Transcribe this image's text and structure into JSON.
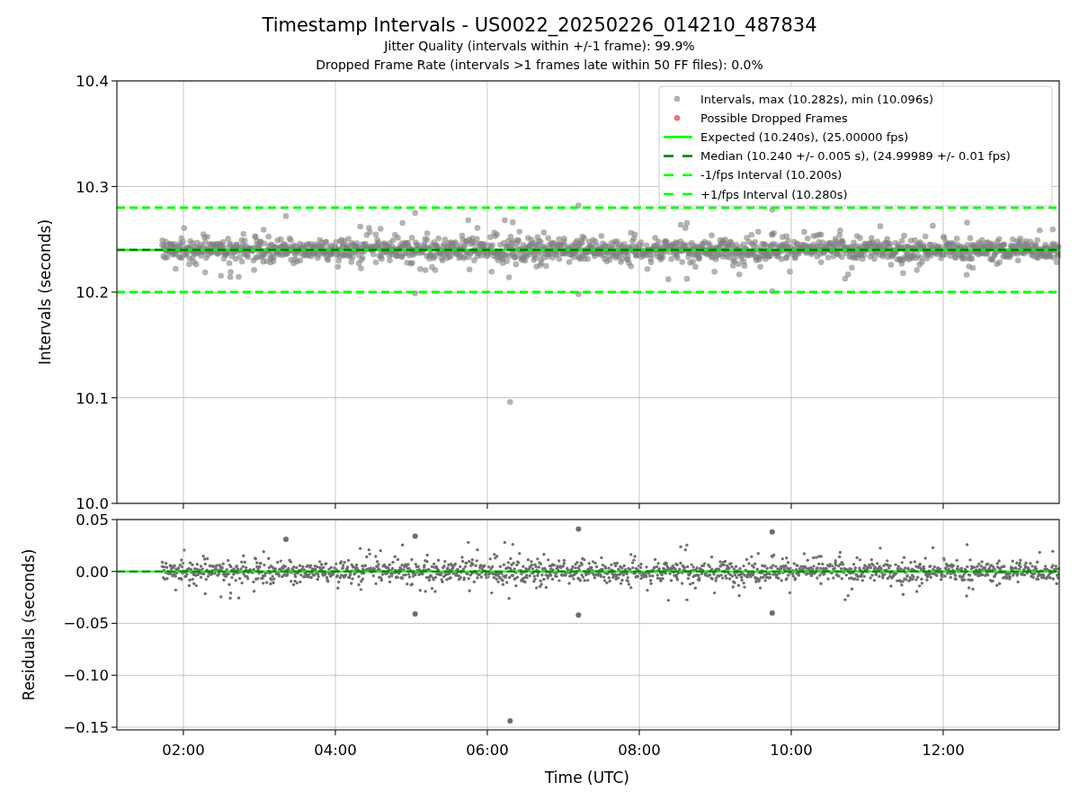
{
  "figure": {
    "title": "Timestamp Intervals - US0022_20250226_014210_487834",
    "subtitle_lines": [
      "Jitter Quality (intervals within +/-1 frame): 99.9%",
      "Dropped Frame Rate (intervals >1 frames late within 50 FF files): 0.0%"
    ]
  },
  "intervals_panel": {
    "legend": [
      {
        "label": "Intervals, max (10.282s), min (10.096s)",
        "kind": "dot",
        "color": "#b0b0b0"
      },
      {
        "label": "Possible Dropped Frames",
        "kind": "dot",
        "color": "#f87070"
      },
      {
        "label": "Expected (10.240s), (25.00000 fps)",
        "kind": "line",
        "color": "#00ff00"
      },
      {
        "label": "Median (10.240 +/- 0.005 s), (24.99989 +/- 0.01 fps)",
        "kind": "dashed",
        "color": "#008000"
      },
      {
        "label": "-1/fps Interval (10.200s)",
        "kind": "dashed",
        "color": "#00ff00"
      },
      {
        "label": "+1/fps Interval (10.280s)",
        "kind": "dashed",
        "color": "#00ff00"
      }
    ],
    "chart_data": {
      "type": "scatter",
      "ylabel": "Intervals (seconds)",
      "xlim": [
        1.125,
        13.527
      ],
      "ylim": [
        10.0,
        10.4
      ],
      "grid": true,
      "yticks": [
        {
          "value": 10.0,
          "label": "10.0"
        },
        {
          "value": 10.1,
          "label": "10.1"
        },
        {
          "value": 10.2,
          "label": "10.2"
        },
        {
          "value": 10.3,
          "label": "10.3"
        },
        {
          "value": 10.4,
          "label": "10.4"
        }
      ],
      "series": [
        {
          "color": "#808080",
          "x": [
            6.3,
            7.2,
            9.75,
            5.05,
            7.2,
            9.75,
            3.35,
            5.05
          ],
          "values": [
            10.096,
            10.282,
            10.278,
            10.199,
            10.198,
            10.201,
            10.272,
            10.275
          ]
        }
      ],
      "ref_lines": [
        {
          "axis": "y",
          "value": 10.24,
          "color": "#00ff00"
        },
        {
          "axis": "y",
          "value": 10.24,
          "color": "#008000"
        },
        {
          "axis": "y",
          "value": 10.2,
          "color": "#00ff00"
        },
        {
          "axis": "y",
          "value": 10.28,
          "color": "#00ff00"
        }
      ]
    }
  },
  "residuals_panel": {
    "chart_data": {
      "type": "scatter",
      "xlabel": "Time (UTC)",
      "ylabel": "Residuals (seconds)",
      "xlim": [
        1.125,
        13.527
      ],
      "ylim": [
        -0.1526,
        0.05
      ],
      "grid": true,
      "xticks": [
        {
          "value": 2,
          "label": "02:00"
        },
        {
          "value": 4,
          "label": "04:00"
        },
        {
          "value": 6,
          "label": "06:00"
        },
        {
          "value": 8,
          "label": "08:00"
        },
        {
          "value": 10,
          "label": "10:00"
        },
        {
          "value": 12,
          "label": "12:00"
        }
      ],
      "yticks": [
        {
          "value": 0.05,
          "label": "0.05"
        },
        {
          "value": 0.0,
          "label": "0.00"
        },
        {
          "value": -0.05,
          "label": "−0.05"
        },
        {
          "value": -0.1,
          "label": "−0.10"
        },
        {
          "value": -0.15,
          "label": "−0.15"
        }
      ],
      "series": [
        {
          "color": "#6e6e6e",
          "x": [
            6.3,
            7.2,
            9.75,
            5.05,
            7.2,
            9.75,
            3.35,
            5.05
          ],
          "values": [
            -0.144,
            0.041,
            0.038,
            -0.041,
            -0.042,
            -0.04,
            0.031,
            0.034
          ]
        }
      ],
      "ref_lines": [
        {
          "axis": "y",
          "value": 0,
          "color": "#00ff00"
        },
        {
          "axis": "y",
          "value": 0,
          "color": "#008000"
        }
      ]
    }
  }
}
